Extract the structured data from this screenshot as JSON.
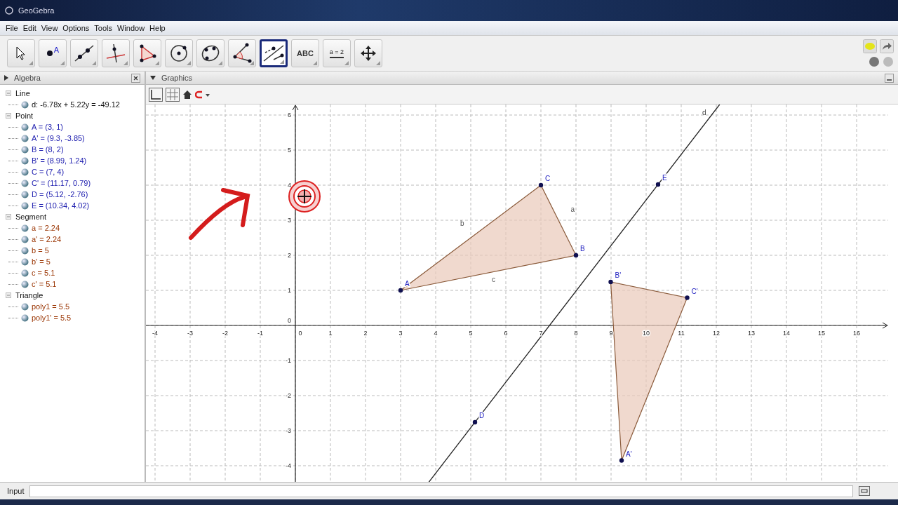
{
  "window": {
    "title": "GeoGebra"
  },
  "menu": [
    "File",
    "Edit",
    "View",
    "Options",
    "Tools",
    "Window",
    "Help"
  ],
  "toolbar": [
    {
      "kind": "pointer",
      "selected": false
    },
    {
      "kind": "point",
      "label": "A",
      "selected": false
    },
    {
      "kind": "line",
      "selected": false
    },
    {
      "kind": "perpendicular",
      "selected": false
    },
    {
      "kind": "polygon",
      "selected": false
    },
    {
      "kind": "circle",
      "selected": false
    },
    {
      "kind": "conic",
      "selected": false
    },
    {
      "kind": "angle",
      "selected": false
    },
    {
      "kind": "reflect",
      "selected": true
    },
    {
      "kind": "text",
      "label": "ABC",
      "selected": false
    },
    {
      "kind": "slider",
      "label": "a = 2",
      "selected": false
    },
    {
      "kind": "move",
      "selected": false
    }
  ],
  "algebra": {
    "title": "Algebra",
    "groups": [
      {
        "name": "Line",
        "items": [
          {
            "text": "d: -6.78x + 5.22y = -49.12",
            "color": "#111111"
          }
        ]
      },
      {
        "name": "Point",
        "items": [
          {
            "text": "A = (3, 1)",
            "color": "#2020b0"
          },
          {
            "text": "A' = (9.3, -3.85)",
            "color": "#2020b0"
          },
          {
            "text": "B = (8, 2)",
            "color": "#2020b0"
          },
          {
            "text": "B' = (8.99, 1.24)",
            "color": "#2020b0"
          },
          {
            "text": "C = (7, 4)",
            "color": "#2020b0"
          },
          {
            "text": "C' = (11.17, 0.79)",
            "color": "#2020b0"
          },
          {
            "text": "D = (5.12, -2.76)",
            "color": "#2020b0"
          },
          {
            "text": "E = (10.34, 4.02)",
            "color": "#2020b0"
          }
        ]
      },
      {
        "name": "Segment",
        "items": [
          {
            "text": "a = 2.24",
            "color": "#993300"
          },
          {
            "text": "a' = 2.24",
            "color": "#993300"
          },
          {
            "text": "b = 5",
            "color": "#993300"
          },
          {
            "text": "b' = 5",
            "color": "#993300"
          },
          {
            "text": "c = 5.1",
            "color": "#993300"
          },
          {
            "text": "c' = 5.1",
            "color": "#993300"
          }
        ]
      },
      {
        "name": "Triangle",
        "items": [
          {
            "text": "poly1 = 5.5",
            "color": "#993300"
          },
          {
            "text": "poly1' = 5.5",
            "color": "#993300"
          }
        ]
      }
    ]
  },
  "graphics": {
    "title": "Graphics",
    "x_ticks": [
      "-4",
      "-3",
      "-2",
      "-1",
      "0",
      "1",
      "2",
      "3",
      "4",
      "5",
      "6",
      "7",
      "8",
      "9",
      "10",
      "11",
      "12",
      "13",
      "14",
      "15",
      "16"
    ],
    "y_ticks": [
      "6",
      "5",
      "4",
      "3",
      "2",
      "1",
      "0",
      "-1",
      "-2",
      "-3",
      "-4"
    ],
    "point_labels": [
      "A",
      "B",
      "C",
      "A'",
      "B'",
      "C'",
      "D",
      "E"
    ],
    "segment_labels": [
      "a",
      "b",
      "c"
    ],
    "line_label": "d"
  },
  "input": {
    "label": "Input"
  }
}
